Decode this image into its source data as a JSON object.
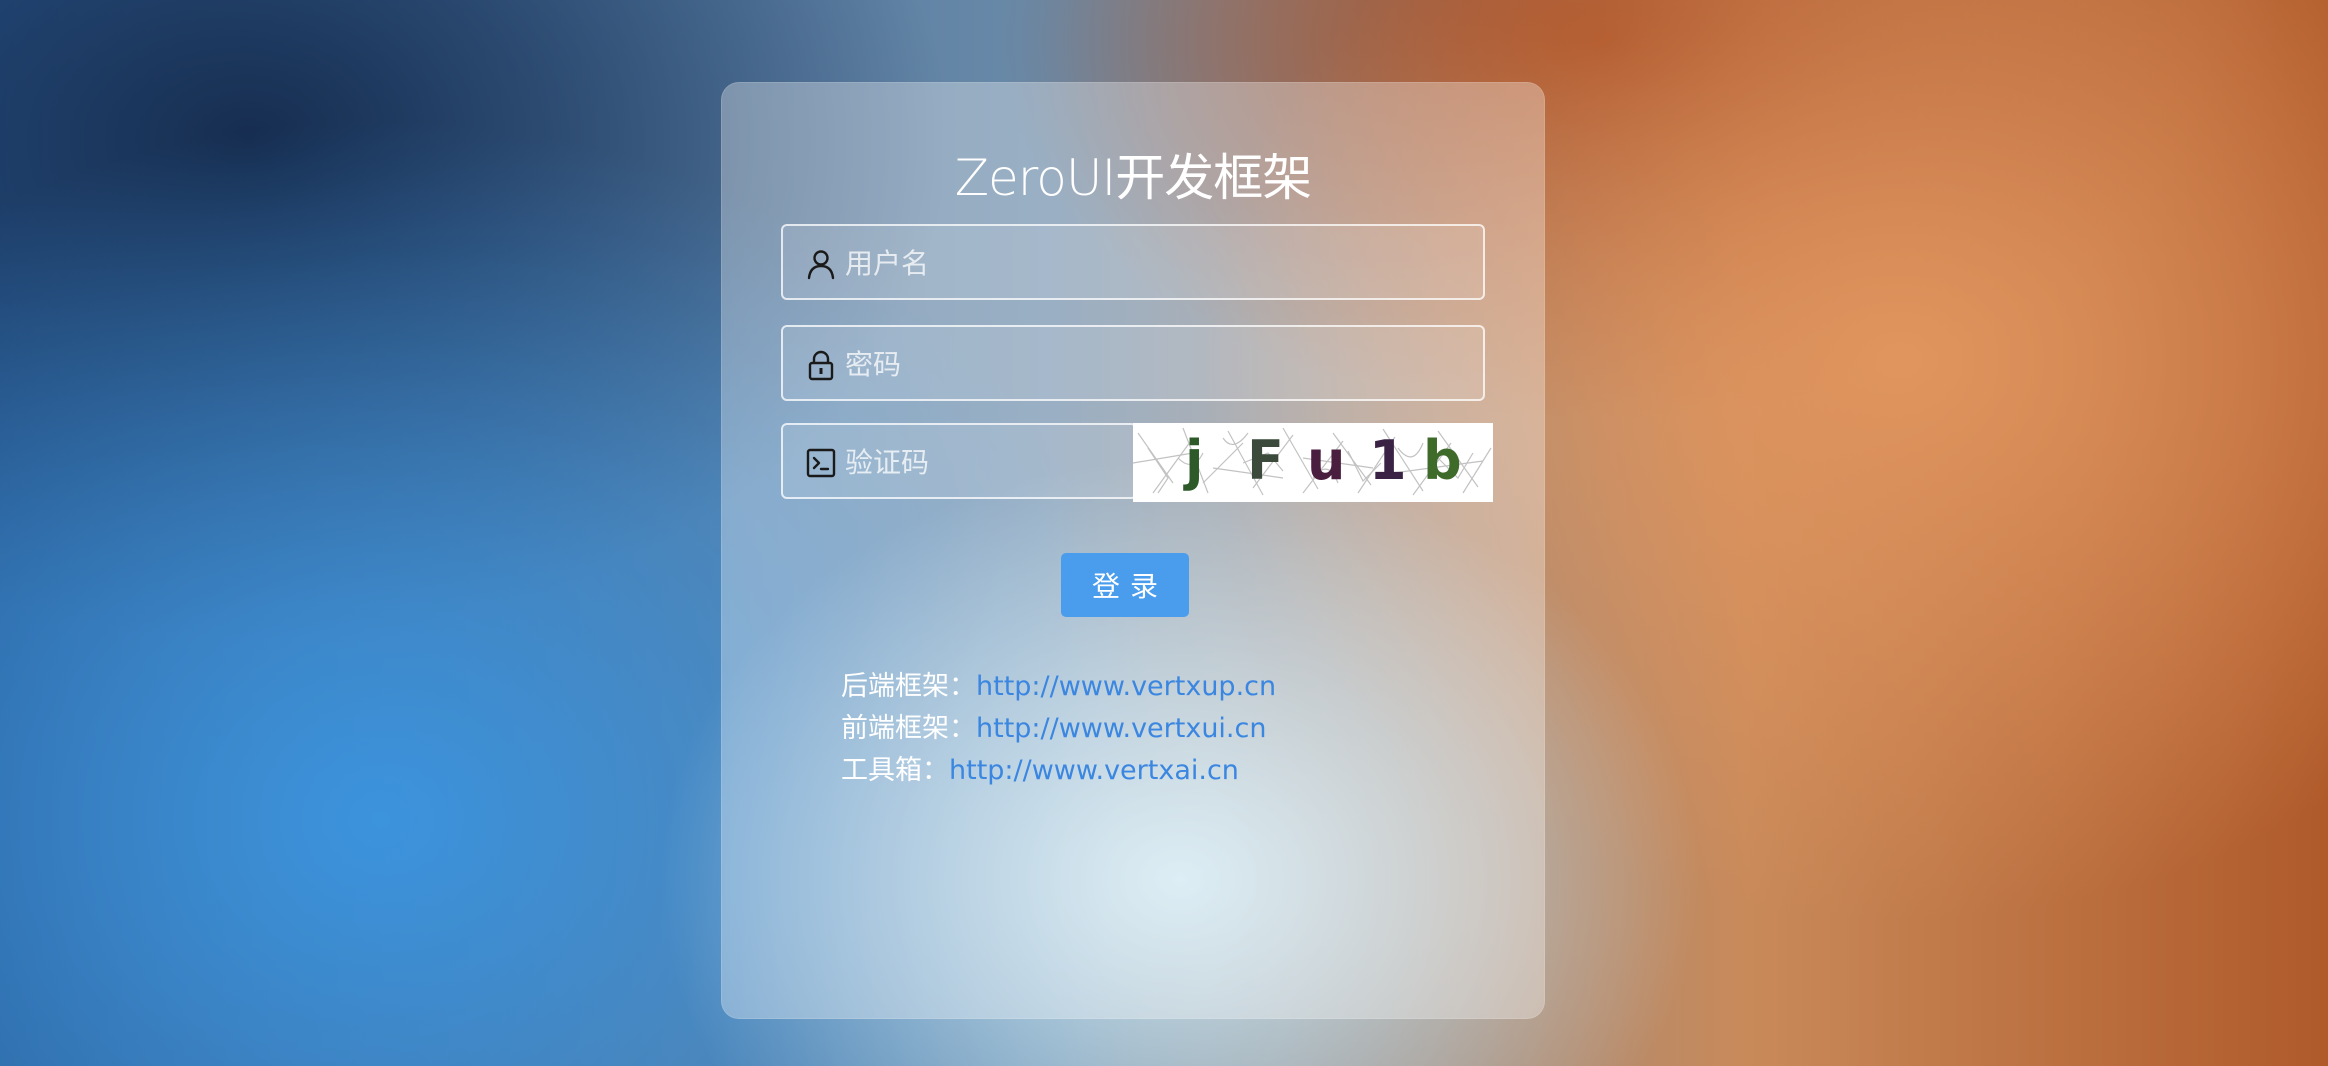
{
  "app": {
    "title": "ZeroUI开发框架"
  },
  "form": {
    "username": {
      "placeholder": "用户名",
      "value": "",
      "icon": "user-icon"
    },
    "password": {
      "placeholder": "密码",
      "value": "",
      "icon": "lock-icon"
    },
    "captcha": {
      "placeholder": "验证码",
      "value": "",
      "icon": "terminal-icon",
      "image_text": [
        "j",
        "F",
        "u",
        "1",
        "b"
      ]
    },
    "login_label": "登录"
  },
  "links": [
    {
      "label": "后端框架：",
      "url": "http://www.vertxup.cn"
    },
    {
      "label": "前端框架：",
      "url": "http://www.vertxui.cn"
    },
    {
      "label": "工具箱：",
      "url": "http://www.vertxai.cn"
    }
  ],
  "colors": {
    "button": "#4a9ded",
    "link": "#3a86e0",
    "captcha_chars": [
      "#2e5a2a",
      "#3b4a3a",
      "#4a1e3e",
      "#3a2244",
      "#3e6a2a"
    ]
  }
}
